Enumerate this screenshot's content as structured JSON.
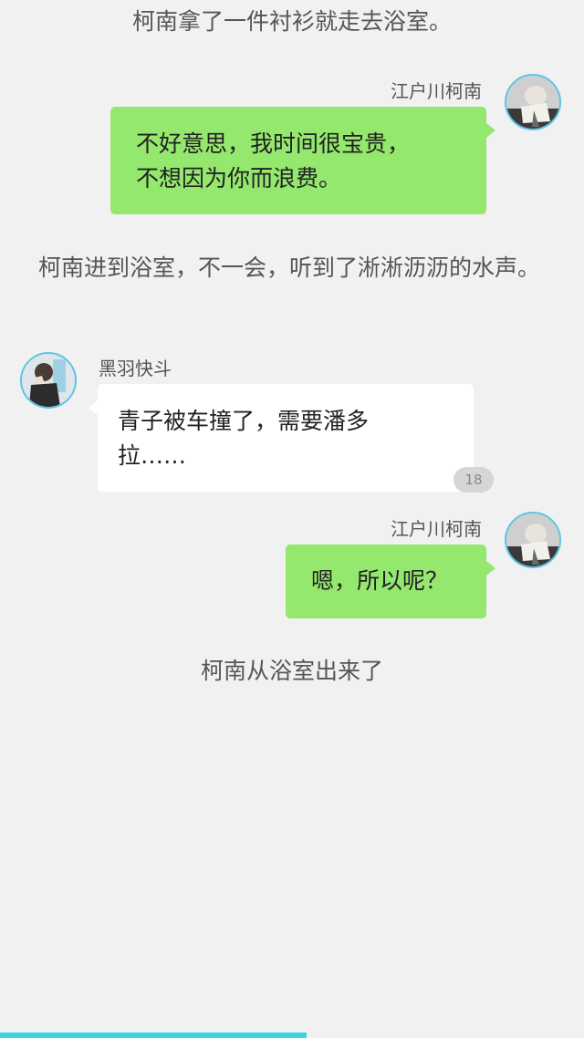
{
  "story": {
    "line1": "柯南拿了一件衬衫就走去浴室。",
    "line2": "柯南进到浴室，不一会，听到了淅淅沥沥的水声。",
    "line3": "柯南从浴室出来了"
  },
  "messages": [
    {
      "sender": "江户川柯南",
      "side": "right",
      "lines": [
        "不好意思，我时间很宝贵，",
        "不想因为你而浪费。"
      ]
    },
    {
      "sender": "黑羽快斗",
      "side": "left",
      "lines": [
        "青子被车撞了，需要潘多",
        "拉……"
      ],
      "badge": "18"
    },
    {
      "sender": "江户川柯南",
      "side": "right",
      "lines": [
        "嗯，所以呢？"
      ]
    }
  ],
  "colors": {
    "background": "#f1f1f1",
    "green_bubble": "#93e86d",
    "white_bubble": "#ffffff",
    "avatar_ring": "#5bc4e6",
    "progress": "#38d6df"
  },
  "icons": {
    "conan_avatar": "conan-avatar-icon",
    "kaito_avatar": "kaito-avatar-icon"
  },
  "reading_progress": 0.525
}
